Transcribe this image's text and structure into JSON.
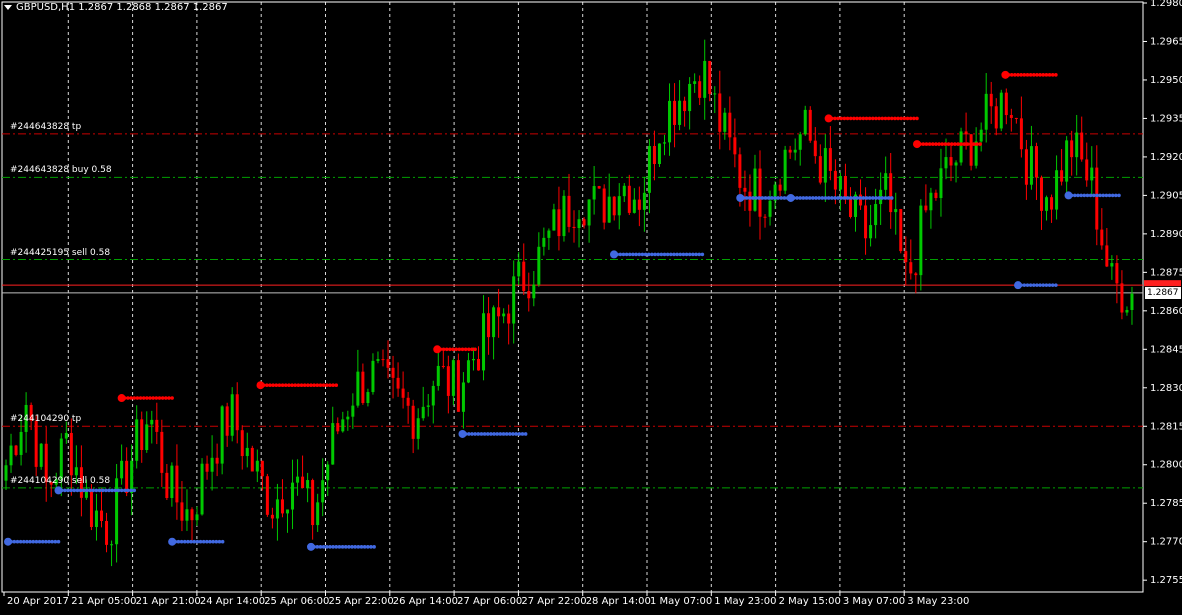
{
  "header": {
    "symbol_title": "GBPUSD,H1  1.2867 1.2868 1.2867 1.2867"
  },
  "colors": {
    "background": "#000000",
    "bull_candle": "#00c800",
    "bear_candle": "#ff0000",
    "grid": "#ffffff",
    "axis": "#ffffff",
    "support_dots": "#4169e1",
    "resistance_dots": "#ff0000",
    "tp_line": "#c80000",
    "order_line": "#00a000",
    "bid_line": "#ff2020",
    "ask_line": "#c0c0c0"
  },
  "order_lines": [
    {
      "label": "#244643828 tp",
      "price": 1.2929,
      "kind": "tp"
    },
    {
      "label": "#244643828 buy 0.58",
      "price": 1.2912,
      "kind": "order"
    },
    {
      "label": "#244425195 sell 0.58",
      "price": 1.288,
      "kind": "order"
    },
    {
      "label": "#244104290 tp",
      "price": 1.2815,
      "kind": "tp"
    },
    {
      "label": "#244104290 sell 0.58",
      "price": 1.2791,
      "kind": "order"
    }
  ],
  "current_price": {
    "label": "1.2867",
    "bid": 1.2867,
    "ask": 1.287
  },
  "chart_data": {
    "type": "candlestick",
    "title": "GBPUSD,H1",
    "ylim": [
      1.275,
      1.298
    ],
    "y_ticks": [
      "1.2980",
      "1.2965",
      "1.2950",
      "1.2935",
      "1.2920",
      "1.2905",
      "1.2890",
      "1.2875",
      "1.2860",
      "1.2845",
      "1.2830",
      "1.2815",
      "1.2800",
      "1.2785",
      "1.2770",
      "1.2755"
    ],
    "x_ticks": [
      "20 Apr 2017",
      "21 Apr 05:00",
      "21 Apr 21:00",
      "24 Apr 14:00",
      "25 Apr 06:00",
      "25 Apr 22:00",
      "26 Apr 14:00",
      "27 Apr 06:00",
      "27 Apr 22:00",
      "28 Apr 14:00",
      "1 May 07:00",
      "1 May 23:00",
      "2 May 15:00",
      "3 May 07:00",
      "3 May 23:00"
    ],
    "close_path": [
      1.28,
      1.2825,
      1.279,
      1.281,
      1.2785,
      1.2775,
      1.28,
      1.282,
      1.279,
      1.278,
      1.2805,
      1.282,
      1.28,
      1.2785,
      1.2795,
      1.278,
      1.281,
      1.283,
      1.2835,
      1.2825,
      1.282,
      1.2835,
      1.283,
      1.2845,
      1.2855,
      1.287,
      1.288,
      1.2895,
      1.2905,
      1.29,
      1.291,
      1.2905,
      1.2935,
      1.2945,
      1.2955,
      1.293,
      1.291,
      1.2905,
      1.292,
      1.293,
      1.2915,
      1.29,
      1.289,
      1.2905,
      1.287,
      1.29,
      1.2915,
      1.2925,
      1.2935,
      1.2945,
      1.2915,
      1.2905,
      1.2925,
      1.291,
      1.287,
      1.2867
    ],
    "support_series": [
      {
        "from": 0,
        "to": 4,
        "level": 1.277
      },
      {
        "from": 4,
        "to": 10,
        "level": 1.279
      },
      {
        "from": 13,
        "to": 17,
        "level": 1.277
      },
      {
        "from": 24,
        "to": 29,
        "level": 1.2768
      },
      {
        "from": 36,
        "to": 41,
        "level": 1.2812
      },
      {
        "from": 48,
        "to": 55,
        "level": 1.2882
      },
      {
        "from": 58,
        "to": 62,
        "level": 1.2904
      },
      {
        "from": 62,
        "to": 70,
        "level": 1.2904
      },
      {
        "from": 80,
        "to": 83,
        "level": 1.287
      },
      {
        "from": 84,
        "to": 88,
        "level": 1.2905
      }
    ],
    "resistance_series": [
      {
        "from": 9,
        "to": 13,
        "level": 1.2826
      },
      {
        "from": 20,
        "to": 26,
        "level": 1.2831
      },
      {
        "from": 34,
        "to": 37,
        "level": 1.2845
      },
      {
        "from": 65,
        "to": 72,
        "level": 1.2935
      },
      {
        "from": 72,
        "to": 77,
        "level": 1.2925
      },
      {
        "from": 79,
        "to": 83,
        "level": 1.2952
      }
    ]
  }
}
